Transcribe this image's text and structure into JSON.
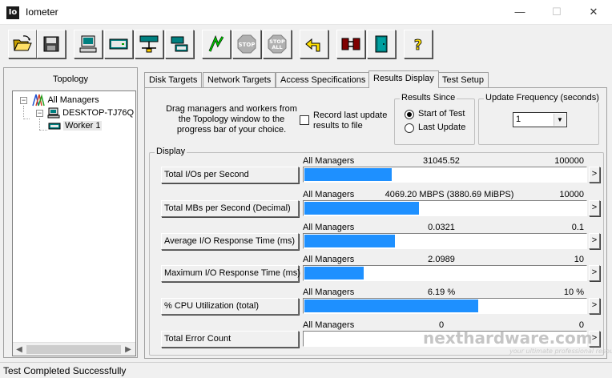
{
  "window": {
    "app_icon_text": "Io",
    "title": "Iometer",
    "minimize": "—",
    "maximize": "☐",
    "close": "✕"
  },
  "toolbar": {
    "buttons": [
      {
        "name": "open-config-button",
        "icon": "open-folder-icon"
      },
      {
        "name": "save-config-button",
        "icon": "save-disk-icon"
      },
      {
        "name": "start-new-manager-button",
        "icon": "computer-icon"
      },
      {
        "name": "start-disk-worker-button",
        "icon": "disk-worker-icon"
      },
      {
        "name": "start-network-worker-button",
        "icon": "network-worker-icon"
      },
      {
        "name": "copy-worker-button",
        "icon": "copy-worker-icon"
      },
      {
        "name": "start-tests-button",
        "icon": "green-flag-icon"
      },
      {
        "name": "stop-button",
        "icon": "stop-icon",
        "label": "STOP"
      },
      {
        "name": "stop-all-button",
        "icon": "stop-all-icon",
        "label": "STOP",
        "sublabel": "ALL"
      },
      {
        "name": "reset-workers-button",
        "icon": "reset-arrow-icon"
      },
      {
        "name": "disconnect-button",
        "icon": "disconnect-icon"
      },
      {
        "name": "exit-button",
        "icon": "exit-door-icon"
      },
      {
        "name": "about-button",
        "icon": "question-mark-icon"
      }
    ]
  },
  "topology": {
    "title": "Topology",
    "items": [
      "All Managers",
      "DESKTOP-TJ76Q",
      "Worker 1"
    ],
    "expand_glyph": "−"
  },
  "tabs": [
    {
      "label": "Disk Targets",
      "active": false
    },
    {
      "label": "Network Targets",
      "active": false
    },
    {
      "label": "Access Specifications",
      "active": false
    },
    {
      "label": "Results Display",
      "active": true
    },
    {
      "label": "Test Setup",
      "active": false
    }
  ],
  "results": {
    "drag_text": "Drag managers and workers from the Topology window to the progress bar of your choice.",
    "record_label": "Record last update results to file",
    "record_checked": false,
    "results_since": {
      "title": "Results Since",
      "options": [
        "Start of Test",
        "Last Update"
      ],
      "selected": 0
    },
    "update_frequency": {
      "title": "Update Frequency (seconds)",
      "value": "1"
    },
    "display_title": "Display",
    "rows": [
      {
        "button": "Total I/Os per Second",
        "source": "All Managers",
        "value": "31045.52",
        "max": "100000",
        "fraction": 0.31
      },
      {
        "button": "Total MBs per Second (Decimal)",
        "source": "All Managers",
        "value": "4069.20 MBPS (3880.69 MiBPS)",
        "max": "10000",
        "fraction": 0.407
      },
      {
        "button": "Average I/O Response Time (ms)",
        "source": "All Managers",
        "value": "0.0321",
        "max": "0.1",
        "fraction": 0.321
      },
      {
        "button": "Maximum I/O Response Time (ms)",
        "source": "All Managers",
        "value": "2.0989",
        "max": "10",
        "fraction": 0.2099
      },
      {
        "button": "% CPU Utilization (total)",
        "source": "All Managers",
        "value": "6.19 %",
        "max": "10 %",
        "fraction": 0.619
      },
      {
        "button": "Total Error Count",
        "source": "All Managers",
        "value": "0",
        "max": "0",
        "fraction": 0
      }
    ],
    "arrow_glyph": ">"
  },
  "status": {
    "text": "Test Completed Successfully"
  },
  "watermark": {
    "main": "nexthardware.com",
    "sub": "your ultimate professional resource"
  },
  "colors": {
    "bar": "#1e90ff"
  }
}
